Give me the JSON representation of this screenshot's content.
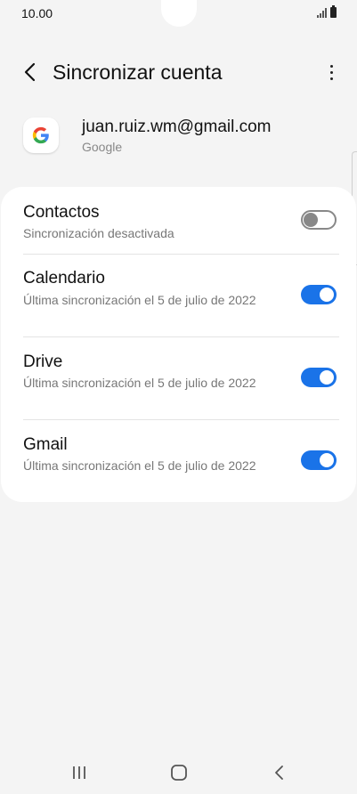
{
  "status": {
    "time": "10.00"
  },
  "header": {
    "title": "Sincronizar cuenta"
  },
  "account": {
    "email": "juan.ruiz.wm@gmail.com",
    "type": "Google"
  },
  "sync_items": [
    {
      "title": "Contactos",
      "subtitle": "Sincronización desactivada",
      "enabled": false
    },
    {
      "title": "Calendario",
      "subtitle": "Última sincronización el 5 de julio de 2022",
      "enabled": true
    },
    {
      "title": "Drive",
      "subtitle": "Última sincronización el 5 de julio de 2022",
      "enabled": true
    },
    {
      "title": "Gmail",
      "subtitle": "Última sincronización el 5 de julio de 2022",
      "enabled": true
    }
  ],
  "colors": {
    "accent": "#1a73e8",
    "background": "#f4f4f4",
    "card": "#ffffff",
    "toggle_off": "#888888"
  },
  "icons": {
    "back": "back-arrow-icon",
    "more": "more-vert-icon",
    "account": "google-logo-icon",
    "nav_recents": "recents-icon",
    "nav_home": "home-icon",
    "nav_back": "back-icon"
  }
}
